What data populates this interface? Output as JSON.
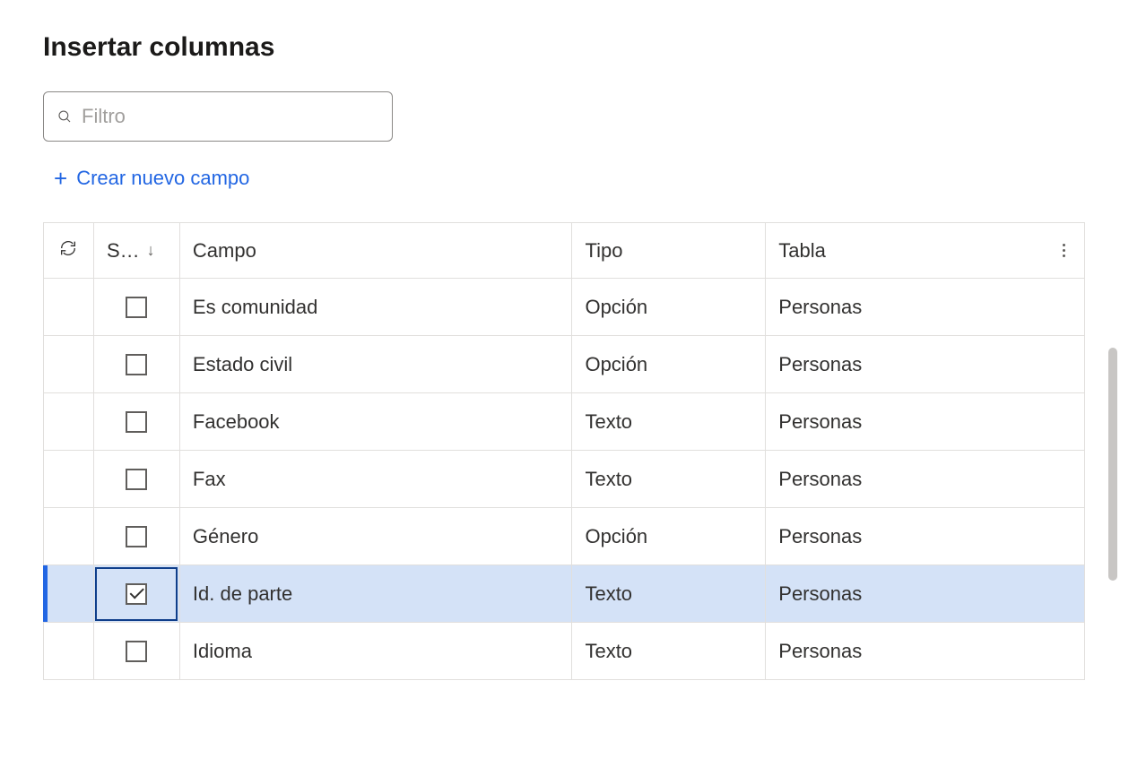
{
  "title": "Insertar columnas",
  "filter": {
    "placeholder": "Filtro",
    "value": ""
  },
  "create_link": "Crear nuevo campo",
  "headers": {
    "select": "S…",
    "campo": "Campo",
    "tipo": "Tipo",
    "tabla": "Tabla"
  },
  "rows": [
    {
      "selected": false,
      "campo": "Es comunidad",
      "tipo": "Opción",
      "tabla": "Personas"
    },
    {
      "selected": false,
      "campo": "Estado civil",
      "tipo": "Opción",
      "tabla": "Personas"
    },
    {
      "selected": false,
      "campo": "Facebook",
      "tipo": "Texto",
      "tabla": "Personas"
    },
    {
      "selected": false,
      "campo": "Fax",
      "tipo": "Texto",
      "tabla": "Personas"
    },
    {
      "selected": false,
      "campo": "Género",
      "tipo": "Opción",
      "tabla": "Personas"
    },
    {
      "selected": true,
      "campo": "Id. de parte",
      "tipo": "Texto",
      "tabla": "Personas"
    },
    {
      "selected": false,
      "campo": "Idioma",
      "tipo": "Texto",
      "tabla": "Personas"
    }
  ]
}
